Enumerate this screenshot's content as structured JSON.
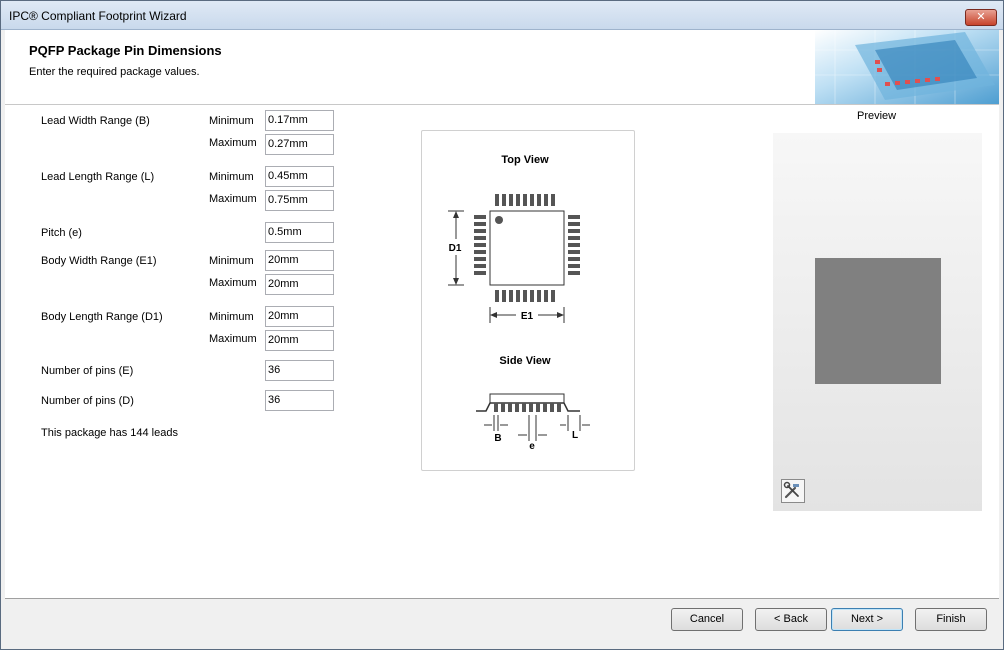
{
  "window": {
    "title": "IPC® Compliant Footprint Wizard",
    "close_label": "✕"
  },
  "header": {
    "title": "PQFP Package Pin Dimensions",
    "subtitle": "Enter the required package values."
  },
  "form": {
    "lead_width": {
      "label": "Lead Width Range (B)",
      "min_label": "Minimum",
      "min": "0.17mm",
      "max_label": "Maximum",
      "max": "0.27mm"
    },
    "lead_length": {
      "label": "Lead Length Range (L)",
      "min_label": "Minimum",
      "min": "0.45mm",
      "max_label": "Maximum",
      "max": "0.75mm"
    },
    "pitch": {
      "label": "Pitch (e)",
      "value": "0.5mm"
    },
    "body_width": {
      "label": "Body Width Range (E1)",
      "min_label": "Minimum",
      "min": "20mm",
      "max_label": "Maximum",
      "max": "20mm"
    },
    "body_length": {
      "label": "Body Length Range (D1)",
      "min_label": "Minimum",
      "min": "20mm",
      "max_label": "Maximum",
      "max": "20mm"
    },
    "pins_e": {
      "label": "Number of pins (E)",
      "value": "36"
    },
    "pins_d": {
      "label": "Number of pins (D)",
      "value": "36"
    },
    "lead_count_text": "This package has 144 leads"
  },
  "diagram": {
    "top_view": "Top View",
    "side_view": "Side View",
    "d1": "D1",
    "e1": "E1",
    "b": "B",
    "e": "e",
    "l": "L"
  },
  "preview": {
    "label": "Preview",
    "tool_icon": "wrench-hammer-icon"
  },
  "buttons": {
    "cancel": "Cancel",
    "back": "< Back",
    "next": "Next >",
    "finish": "Finish"
  },
  "colors": {
    "pad": "#808080",
    "title_bar": "#c9d9ec"
  }
}
